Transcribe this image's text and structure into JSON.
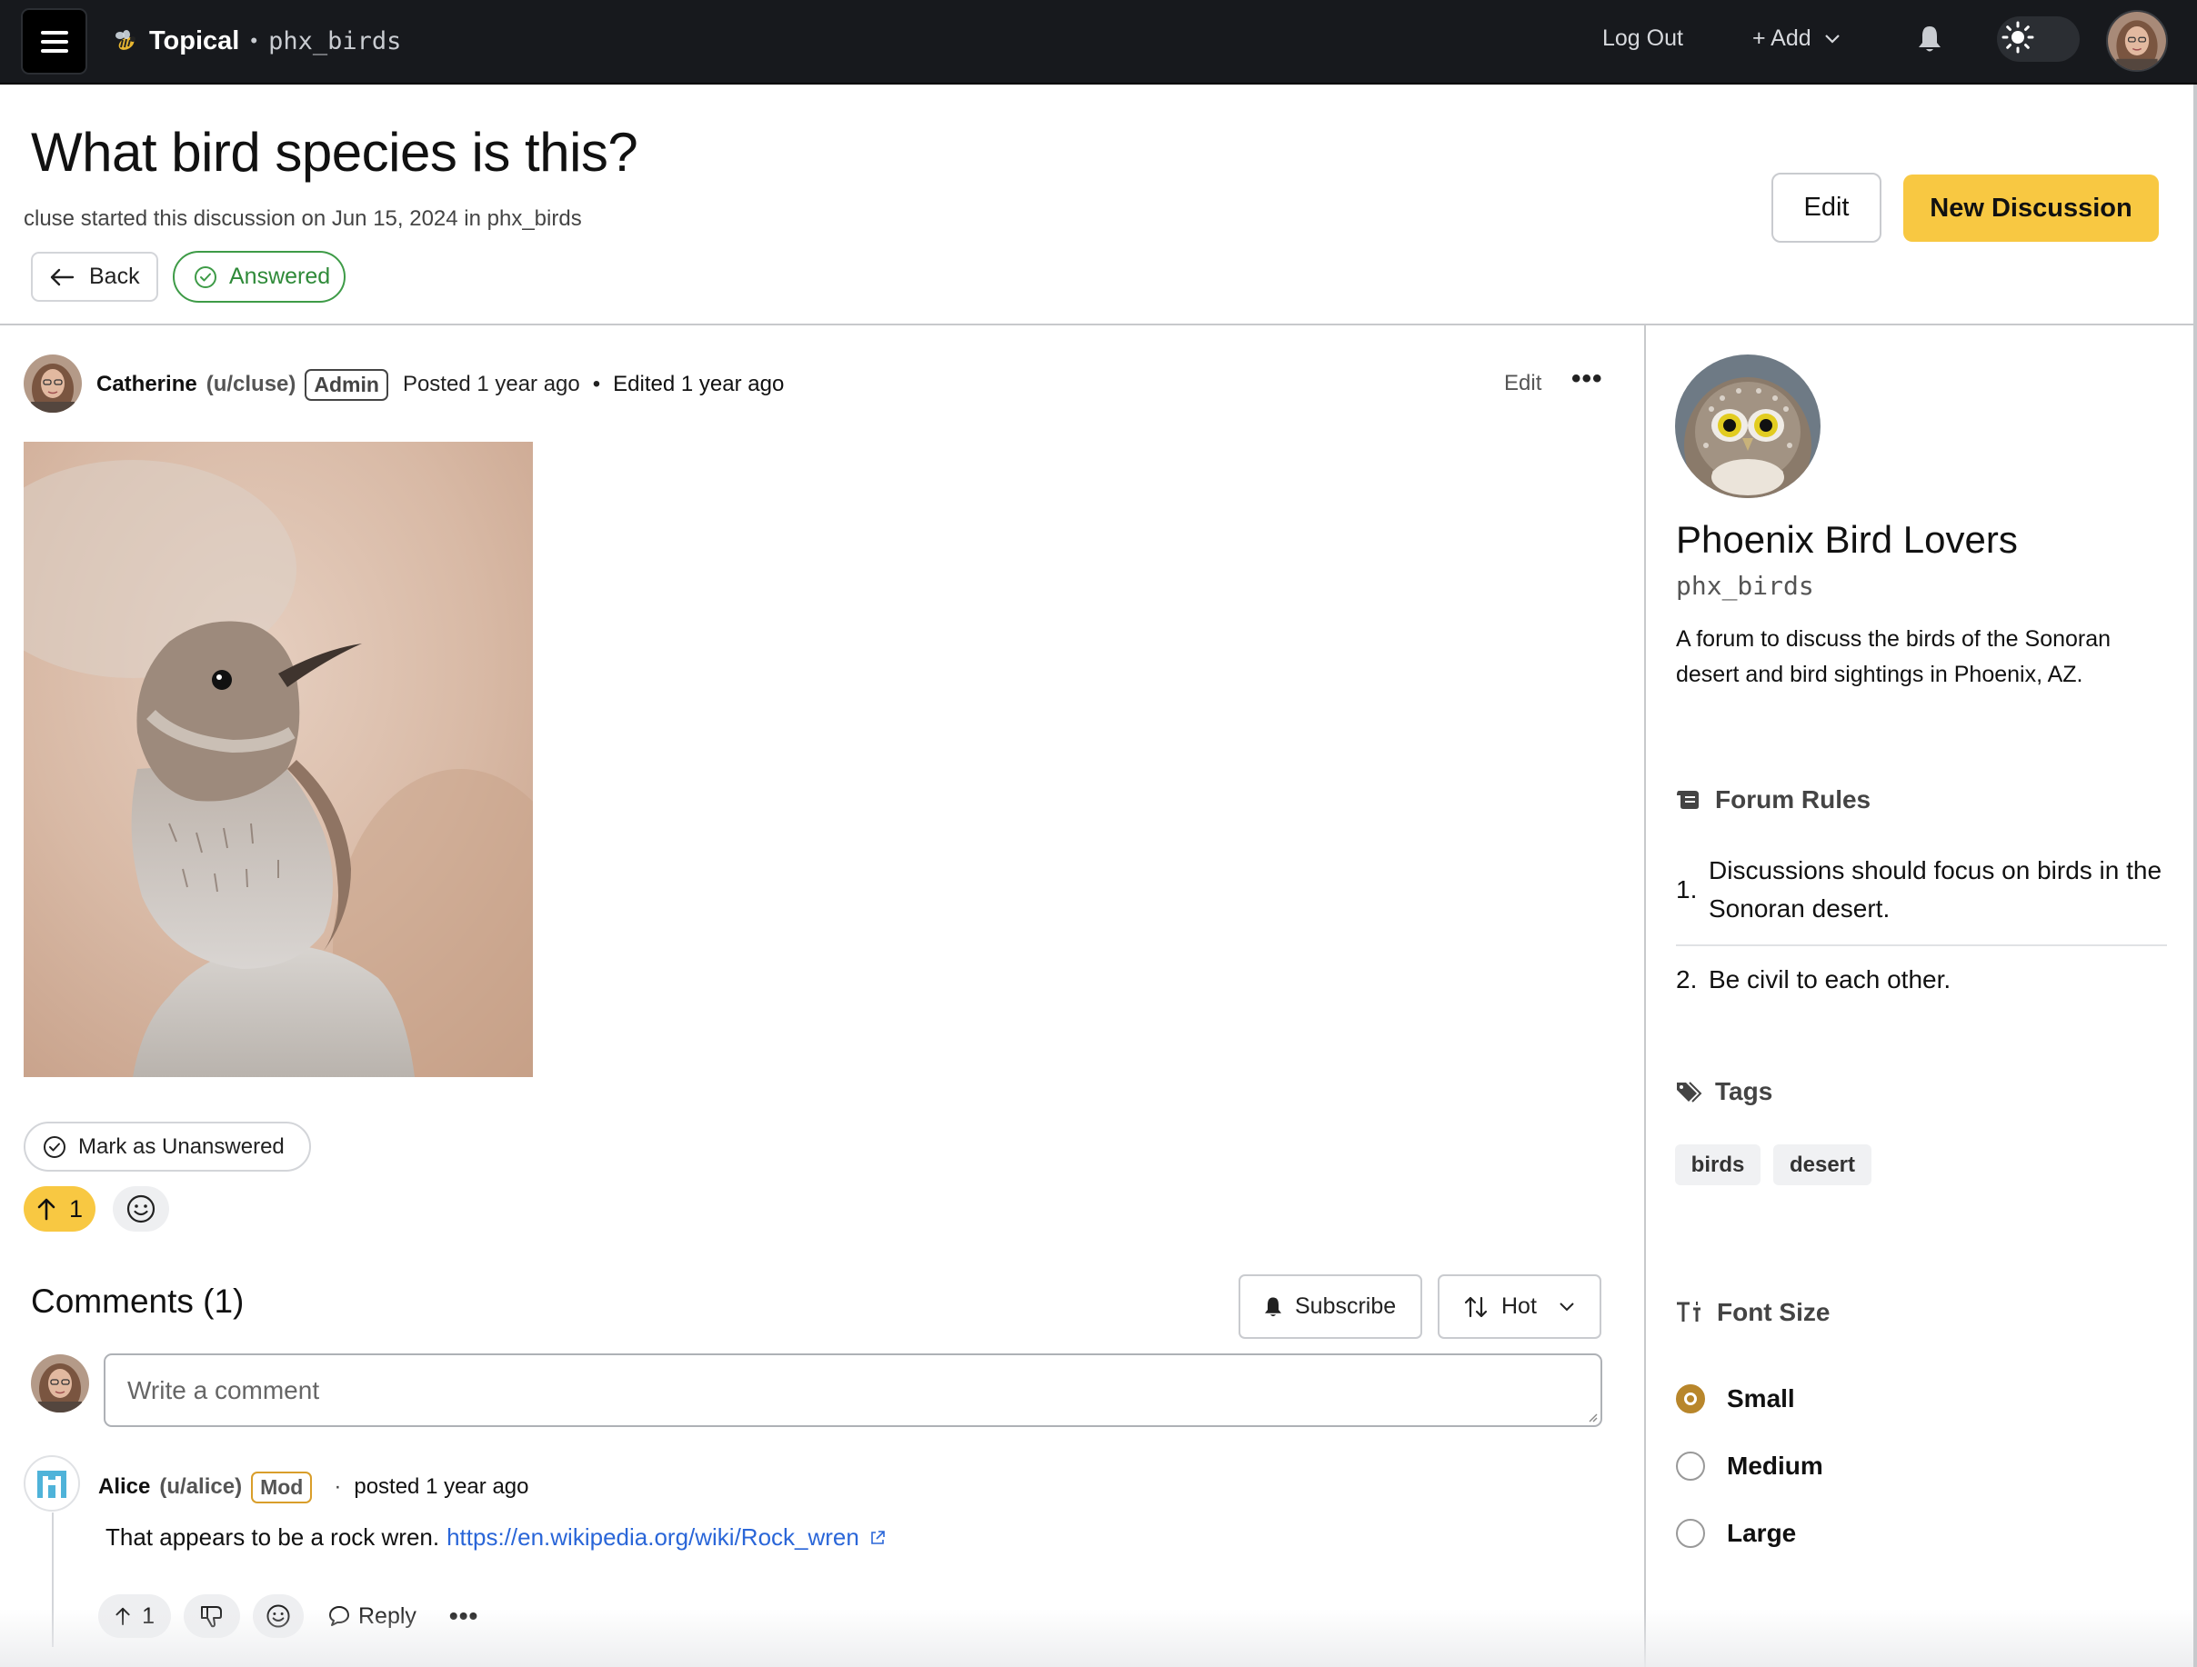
{
  "app": {
    "brand": "Topical",
    "separator": "•",
    "forum_slug": "phx_birds",
    "logout_label": "Log Out",
    "add_label": "+ Add"
  },
  "header": {
    "title": "What bird species is this?",
    "subtitle": "cluse started this discussion on Jun 15, 2024 in phx_birds",
    "back_label": "Back",
    "answered_label": "Answered",
    "edit_label": "Edit",
    "new_discussion_label": "New Discussion"
  },
  "post": {
    "author": "Catherine",
    "handle": "(u/cluse)",
    "badge": "Admin",
    "posted": "Posted 1 year ago",
    "bullet": "•",
    "edited": "Edited 1 year ago",
    "edit_label": "Edit",
    "more_label": "•••",
    "mark_unanswered_label": "Mark as Unanswered",
    "upvotes": "1"
  },
  "comments": {
    "title": "Comments (1)",
    "subscribe_label": "Subscribe",
    "sort_label": "Hot",
    "input_placeholder": "Write a comment",
    "items": [
      {
        "author": "Alice",
        "handle": "(u/alice)",
        "badge": "Mod",
        "separator": "·",
        "posted": "posted 1 year ago",
        "text": "That appears to be a rock wren.",
        "link": "https://en.wikipedia.org/wiki/Rock_wren",
        "upvotes": "1",
        "reply_label": "Reply",
        "more_label": "•••"
      }
    ]
  },
  "sidebar": {
    "forum_name": "Phoenix Bird Lovers",
    "forum_handle": "phx_birds",
    "description": "A forum to discuss the birds of the Sonoran desert and bird sightings in Phoenix, AZ.",
    "rules_heading": "Forum Rules",
    "rules": [
      {
        "num": "1.",
        "text": "Discussions should focus on birds in the Sonoran desert."
      },
      {
        "num": "2.",
        "text": "Be civil to each other."
      }
    ],
    "tags_heading": "Tags",
    "tags": [
      "birds",
      "desert"
    ],
    "font_heading": "Font Size",
    "font_options": [
      "Small",
      "Medium",
      "Large"
    ],
    "font_selected": "Small"
  },
  "colors": {
    "accent_yellow": "#f8c842",
    "answered_green": "#3e9b47",
    "link_blue": "#2a66d8",
    "mod_border": "#d99e2a",
    "topbar": "#17191d"
  }
}
